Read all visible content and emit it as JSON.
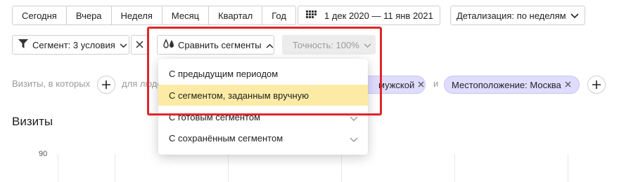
{
  "period": {
    "items": [
      "Сегодня",
      "Вчера",
      "Неделя",
      "Месяц",
      "Квартал",
      "Год"
    ]
  },
  "date_range": {
    "label": "1 дек 2020 — 11 янв 2021",
    "icon": "calendar-grid-icon"
  },
  "detail": {
    "label": "Детализация: по неделям"
  },
  "segment": {
    "label": "Сегмент: 3 условия"
  },
  "compare": {
    "label": "Сравнить сегменты"
  },
  "accuracy": {
    "label": "Точность: 100%"
  },
  "filters": {
    "visits_in": "Визиты, в которых",
    "for_people": "для людей",
    "chip_male": "мужской",
    "and": "и",
    "chip_location": "Местоположение: Москва"
  },
  "dropdown": {
    "items": [
      "С предыдущим периодом",
      "С сегментом, заданным вручную",
      "С готовым сегментом",
      "С сохранённым сегментом"
    ]
  },
  "chart": {
    "title": "Визиты",
    "y_ticks": [
      "90"
    ]
  },
  "colors": {
    "highlight_frame": "#e0252a",
    "active_item": "#fdeba5",
    "chip": "#dfdcff"
  }
}
